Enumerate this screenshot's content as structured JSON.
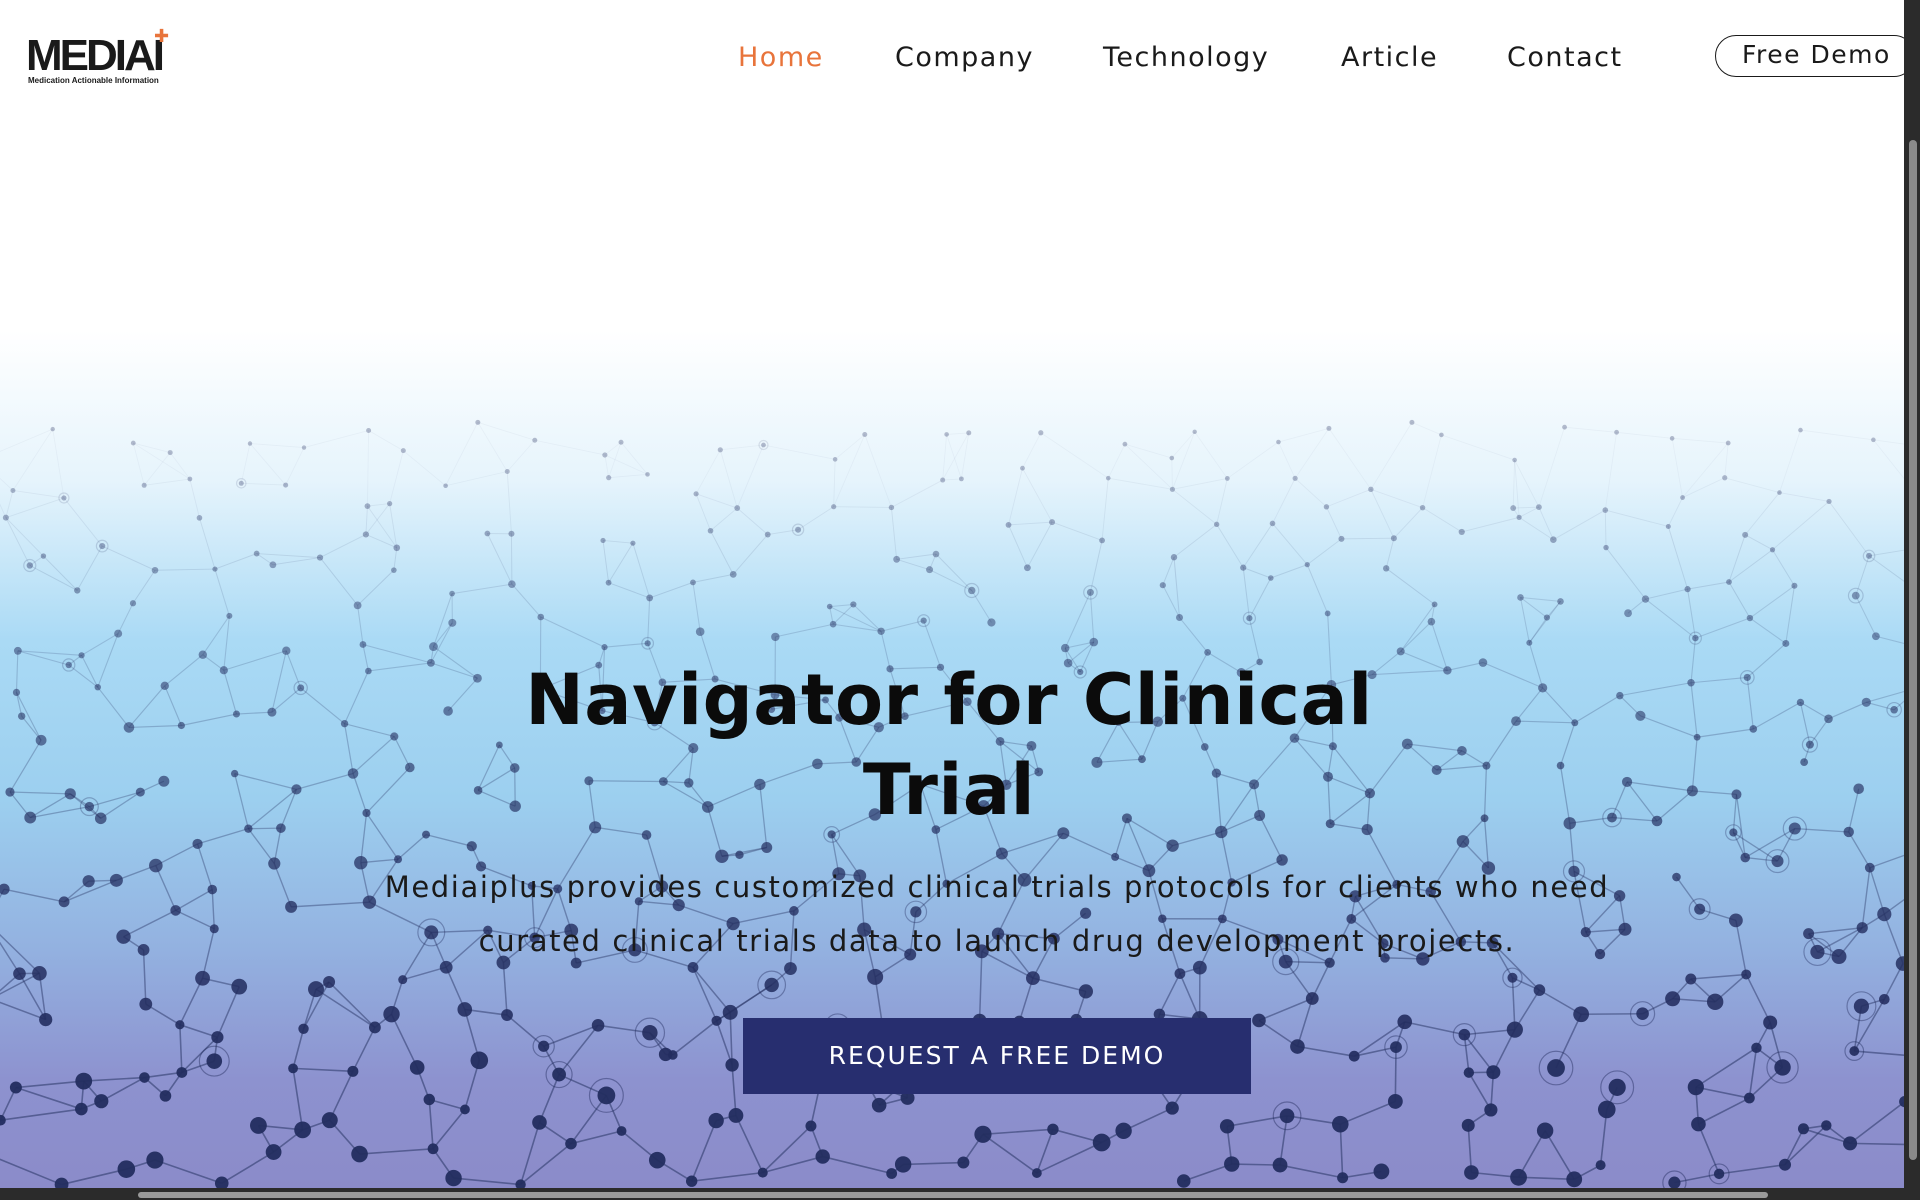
{
  "brand": {
    "logo_text": "MEDIAI",
    "logo_accent_icon": "cross-plus-icon",
    "tagline": "Medication Actionable Information",
    "accent_color": "#e8743b",
    "primary_color": "#272e6f"
  },
  "nav": {
    "items": [
      {
        "label": "Home",
        "active": true
      },
      {
        "label": "Company",
        "active": false
      },
      {
        "label": "Technology",
        "active": false
      },
      {
        "label": "Article",
        "active": false
      },
      {
        "label": "Contact",
        "active": false
      }
    ],
    "cta_label": "Free Demo"
  },
  "hero": {
    "title": "Navigator for Clinical Trial",
    "subtitle_line1": "Mediaiplus provides customized clinical trials protocols for clients who need",
    "subtitle_line2": "curated clinical trials data to launch drug development projects.",
    "cta_label": "REQUEST A FREE DEMO"
  }
}
